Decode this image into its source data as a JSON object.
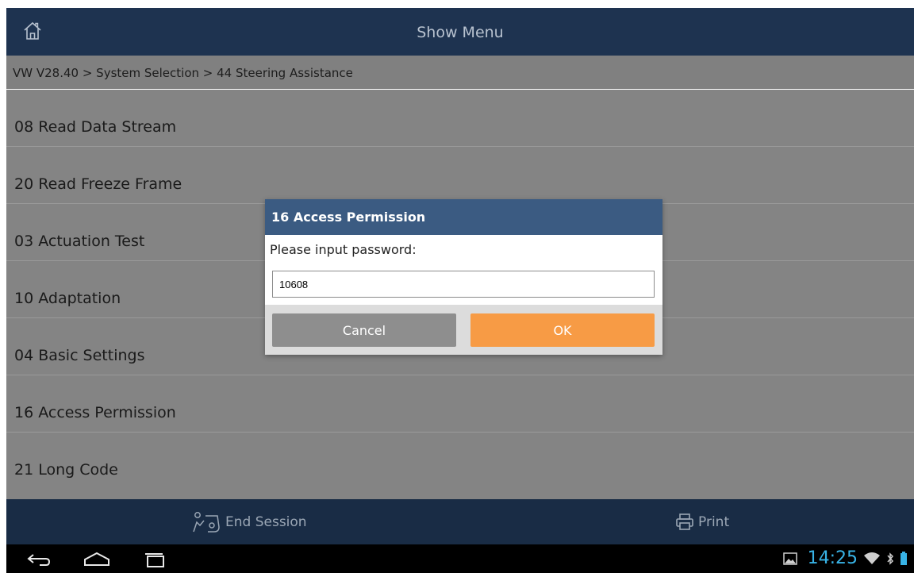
{
  "header": {
    "title": "Show Menu",
    "home_icon": "home-icon"
  },
  "breadcrumb": "VW V28.40 > System Selection > 44 Steering Assistance",
  "menu": {
    "items": [
      {
        "label": "08 Read Data Stream"
      },
      {
        "label": "20 Read Freeze Frame"
      },
      {
        "label": "03 Actuation Test"
      },
      {
        "label": "10 Adaptation"
      },
      {
        "label": "04 Basic Settings"
      },
      {
        "label": "16 Access Permission"
      },
      {
        "label": "21 Long Code"
      }
    ]
  },
  "dialog": {
    "title": "16 Access Permission",
    "prompt": "Please input password:",
    "input_value": "10608",
    "cancel_label": "Cancel",
    "ok_label": "OK"
  },
  "actionbar": {
    "end_session_label": "End Session",
    "end_session_icon": "end-session-icon",
    "print_label": "Print",
    "print_icon": "print-icon"
  },
  "statusbar": {
    "time": "14:25"
  },
  "colors": {
    "header_bg": "#1e3350",
    "dialog_title_bg": "#3b5b82",
    "ok_button": "#f79b45",
    "cancel_button": "#8e8e8e",
    "clock": "#38b3e6"
  }
}
